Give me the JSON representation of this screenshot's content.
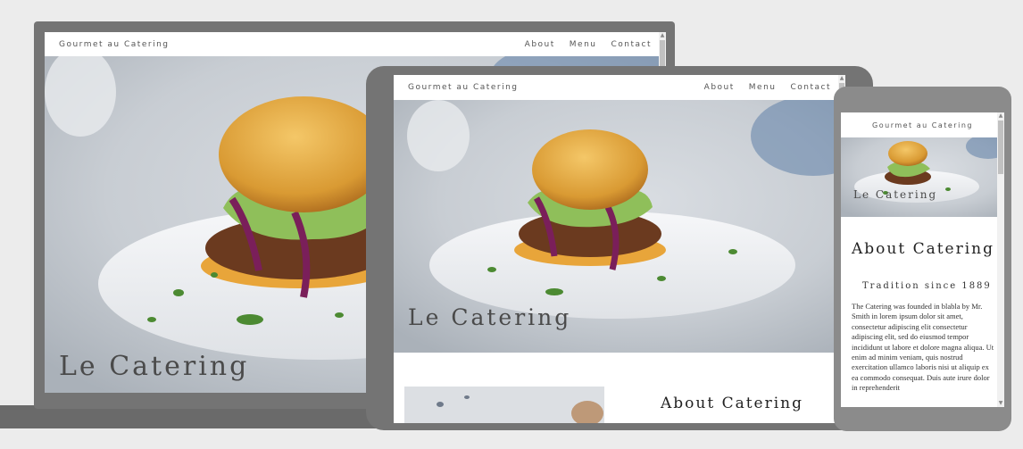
{
  "site": {
    "brand": "Gourmet au Catering",
    "nav": [
      "About",
      "Menu",
      "Contact"
    ],
    "hero_title": "Le Catering",
    "about_title": "About Catering",
    "about_subtitle": "Tradition since 1889",
    "about_text": "The Catering was founded in blabla by Mr. Smith in lorem ipsum dolor sit amet, consectetur adipiscing elit consectetur adipiscing elit, sed do eiusmod tempor incididunt ut labore et dolore magna aliqua. Ut enim ad minim veniam, quis nostrud exercitation ullamco laboris nisi ut aliquip ex ea commodo consequat. Duis aute irure dolor in reprehenderit"
  },
  "icons": {
    "scroll_up": "triangle-up",
    "scroll_down": "triangle-down"
  },
  "colors": {
    "device_frame": "#747474",
    "page_background": "#ececec",
    "hero_text": "#4a4a4a"
  }
}
